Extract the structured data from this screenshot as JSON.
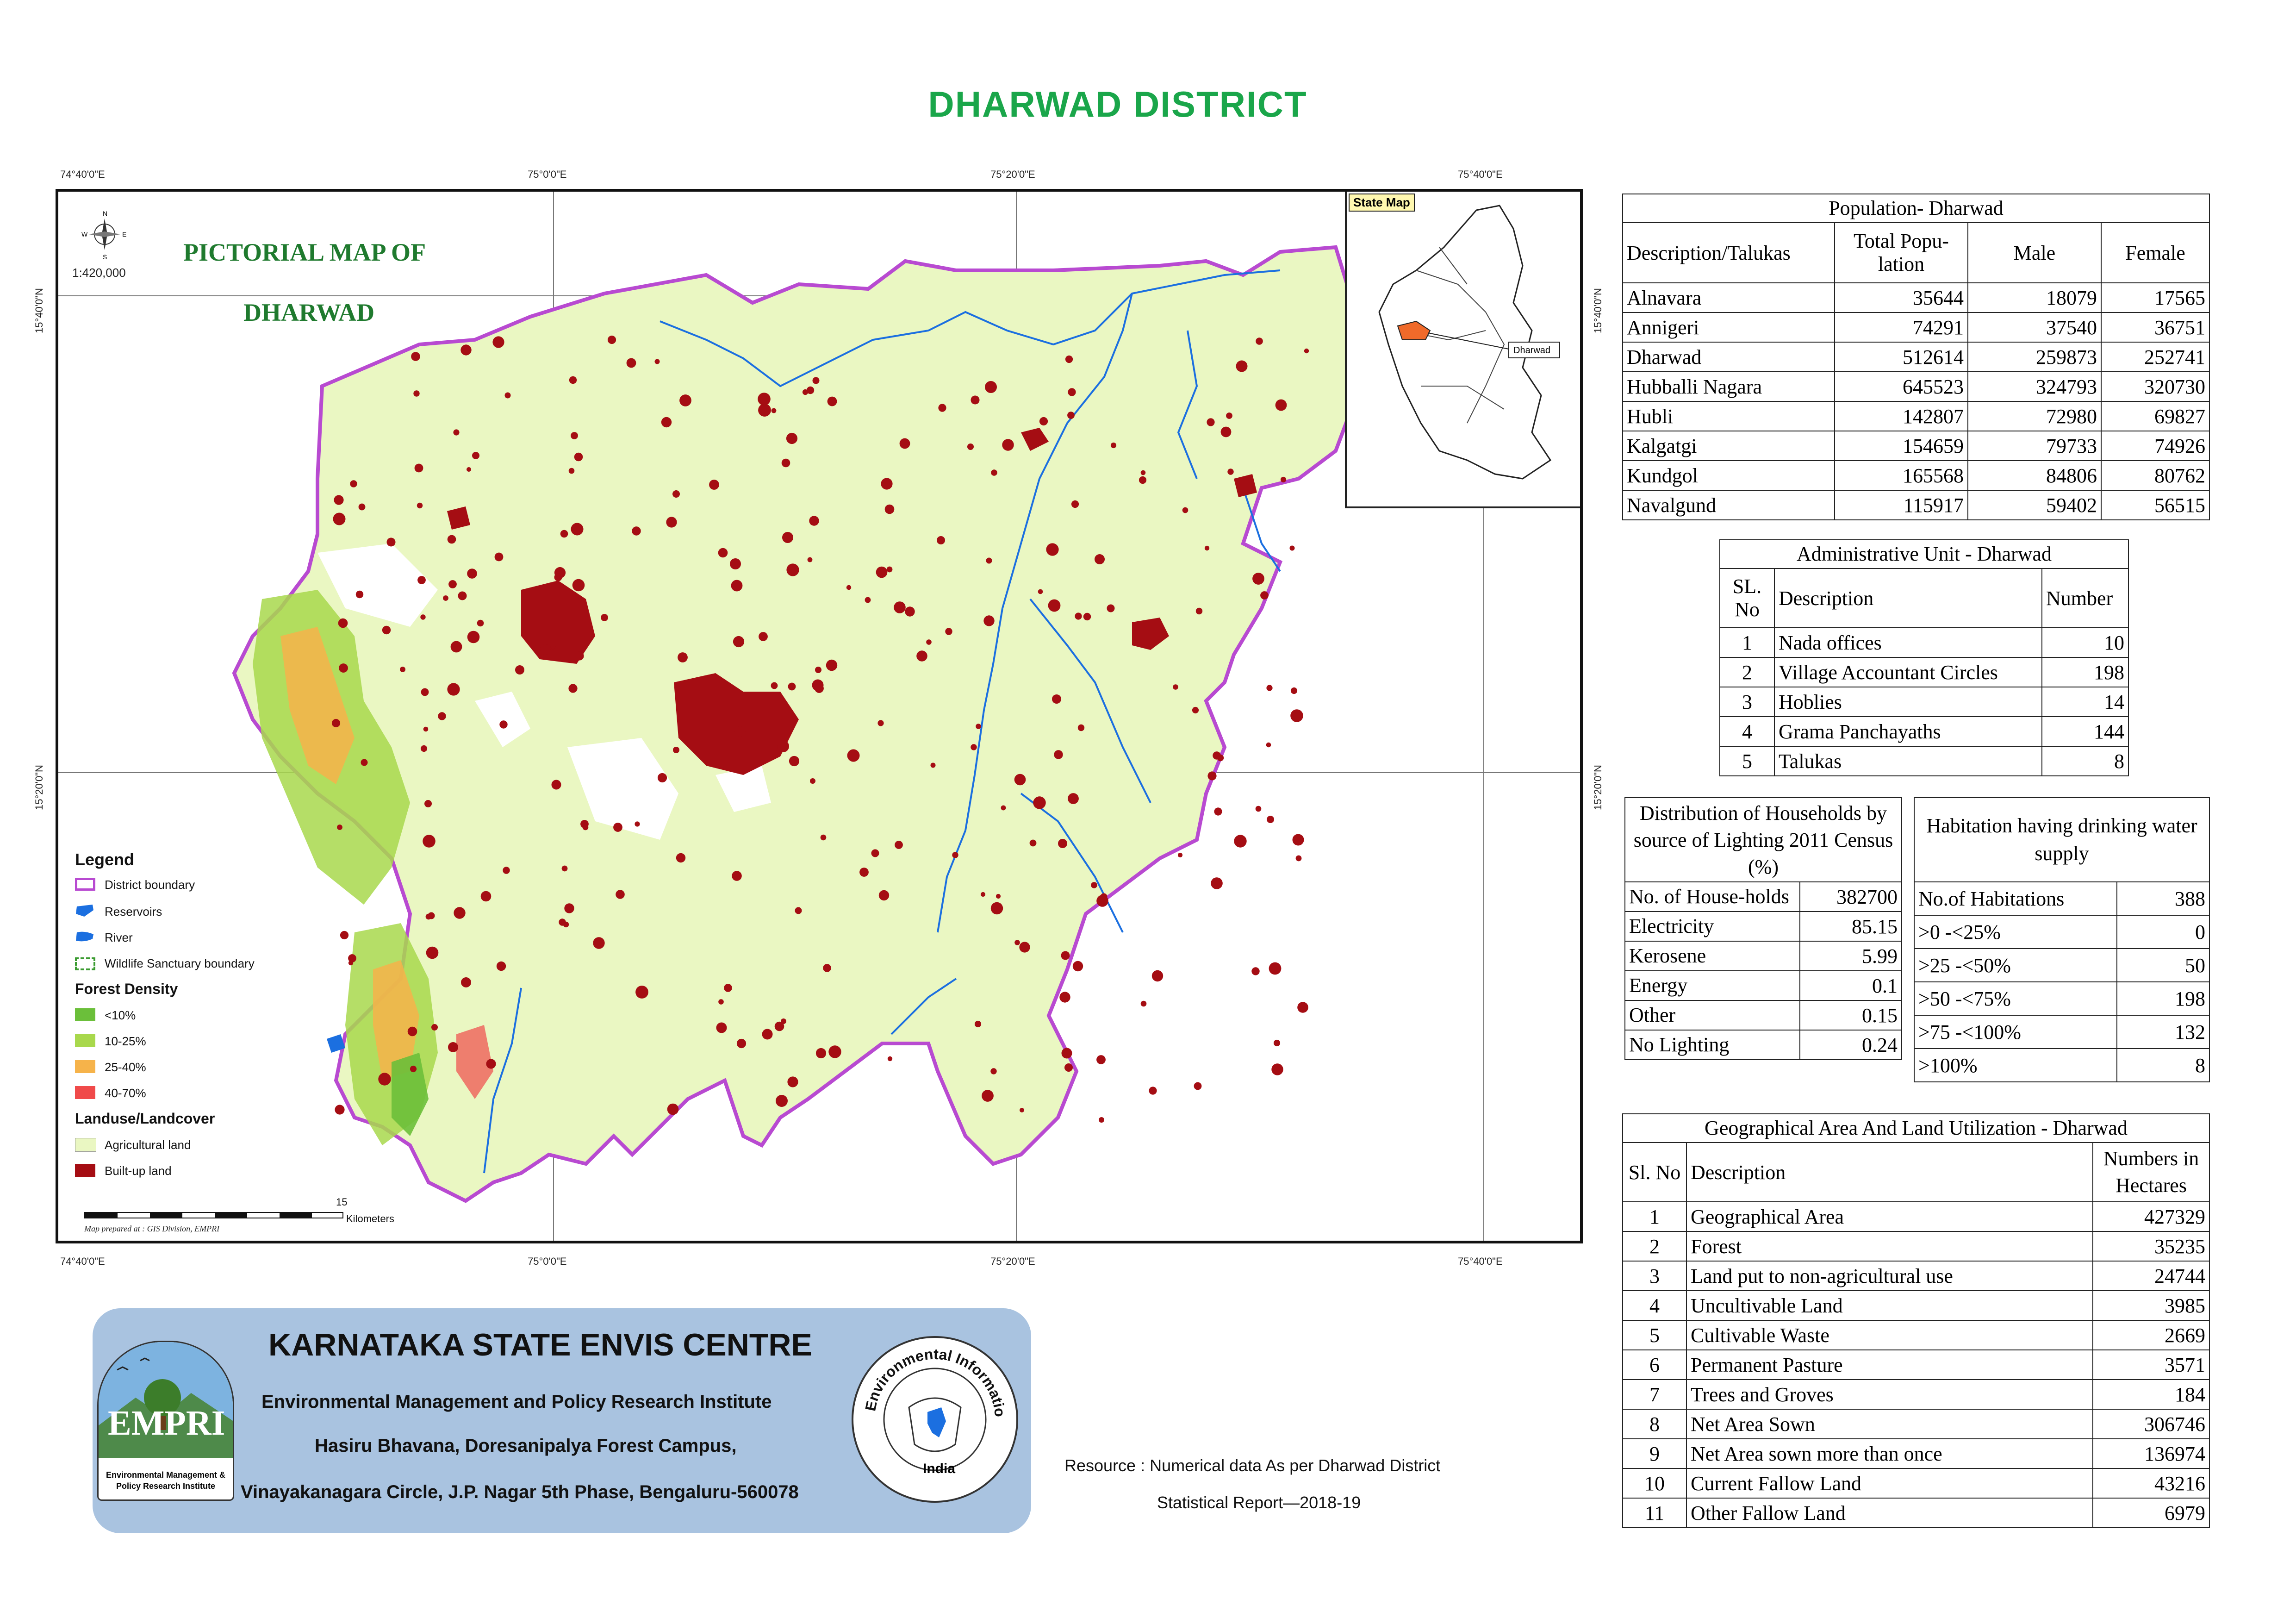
{
  "title": "DHARWAD DISTRICT",
  "map": {
    "heading_line1": "PICTORIAL MAP OF",
    "heading_line2": "DHARWAD",
    "scale_text": "1:420,000",
    "compass": {
      "n": "N",
      "s": "S",
      "e": "E",
      "w": "W"
    },
    "top_ticks": [
      "74°40'0\"E",
      "75°0'0\"E",
      "75°20'0\"E",
      "75°40'0\"E"
    ],
    "bottom_ticks": [
      "74°40'0\"E",
      "75°0'0\"E",
      "75°20'0\"E",
      "75°40'0\"E"
    ],
    "left_ticks": [
      "15°40'0\"N",
      "15°20'0\"N"
    ],
    "right_ticks": [
      "15°40'0\"N",
      "15°20'0\"N"
    ],
    "inset_label": "State Map",
    "inset_callout": "Dharwad",
    "scalebar_end": "15",
    "scalebar_unit": "Kilometers",
    "credit": "Map prepared at : GIS Division, EMPRI",
    "colors": {
      "agri": "#eaf7c2",
      "builtup": "#a50d13",
      "boundary": "#b84ad1",
      "river": "#1b6fe0",
      "open": "#ffffff",
      "forest1": "#6bbf3a",
      "forest2": "#a8d84c",
      "forest3": "#f6b34a",
      "forest4": "#f04a4a"
    }
  },
  "legend": {
    "title": "Legend",
    "items": [
      {
        "label": "District boundary",
        "icon": "boundary-swatch"
      },
      {
        "label": "Reservoirs",
        "icon": "reservoir-swatch"
      },
      {
        "label": "River",
        "icon": "river-swatch"
      },
      {
        "label": "Wildlife Sanctuary boundary",
        "icon": "sanctuary-swatch"
      }
    ],
    "forest_title": "Forest Density",
    "forest_items": [
      {
        "label": "<10%",
        "color": "#6bbf3a"
      },
      {
        "label": "10-25%",
        "color": "#a8d84c"
      },
      {
        "label": "25-40%",
        "color": "#f6b34a"
      },
      {
        "label": "40-70%",
        "color": "#f04a4a"
      }
    ],
    "landuse_title": "Landuse/Landcover",
    "landuse_items": [
      {
        "label": "Agricultural land",
        "color": "#eaf7c2"
      },
      {
        "label": "Built-up land",
        "color": "#a50d13"
      }
    ]
  },
  "population": {
    "caption": "Population- Dharwad",
    "headers": [
      "Description/Talukas",
      "Total Popu-lation",
      "Male",
      "Female"
    ],
    "rows": [
      [
        "Alnavara",
        "35644",
        "18079",
        "17565"
      ],
      [
        "Annigeri",
        "74291",
        "37540",
        "36751"
      ],
      [
        "Dharwad",
        "512614",
        "259873",
        "252741"
      ],
      [
        "Hubballi Nagara",
        "645523",
        "324793",
        "320730"
      ],
      [
        "Hubli",
        "142807",
        "72980",
        "69827"
      ],
      [
        "Kalgatgi",
        "154659",
        "79733",
        "74926"
      ],
      [
        "Kundgol",
        "165568",
        "84806",
        "80762"
      ],
      [
        "Navalgund",
        "115917",
        "59402",
        "56515"
      ]
    ]
  },
  "admin": {
    "caption": "Administrative Unit - Dharwad",
    "headers": [
      "SL. No",
      "Description",
      "Number"
    ],
    "rows": [
      [
        "1",
        "Nada offices",
        "10"
      ],
      [
        "2",
        "Village Accountant Circles",
        "198"
      ],
      [
        "3",
        "Hoblies",
        "14"
      ],
      [
        "4",
        "Grama Panchayaths",
        "144"
      ],
      [
        "5",
        "Talukas",
        "8"
      ]
    ]
  },
  "households": {
    "caption": "Distribution of Households by source of Lighting 2011 Census (%)",
    "rows": [
      [
        "No. of House-holds",
        "382700"
      ],
      [
        "Electricity",
        "85.15"
      ],
      [
        "Kerosene",
        "5.99"
      ],
      [
        "Energy",
        "0.1"
      ],
      [
        "Other",
        "0.15"
      ],
      [
        "No Lighting",
        "0.24"
      ]
    ]
  },
  "habitation": {
    "caption": "Habitation having drinking water supply",
    "rows": [
      [
        "No.of Habitations",
        "388"
      ],
      [
        ">0 -<25%",
        "0"
      ],
      [
        ">25 -<50%",
        "50"
      ],
      [
        ">50 -<75%",
        "198"
      ],
      [
        ">75 -<100%",
        "132"
      ],
      [
        ">100%",
        "8"
      ]
    ]
  },
  "geo": {
    "caption": "Geographical Area  And Land Utilization - Dharwad",
    "headers": [
      "Sl. No",
      "Description",
      "Numbers in Hectares"
    ],
    "rows": [
      [
        "1",
        "Geographical Area",
        "427329"
      ],
      [
        "2",
        "Forest",
        "35235"
      ],
      [
        "3",
        "Land put to non-agricultural use",
        "24744"
      ],
      [
        "4",
        "Uncultivable Land",
        "3985"
      ],
      [
        "5",
        "Cultivable Waste",
        "2669"
      ],
      [
        "6",
        "Permanent Pasture",
        "3571"
      ],
      [
        "7",
        "Trees and Groves",
        "184"
      ],
      [
        "8",
        "Net Area Sown",
        "306746"
      ],
      [
        "9",
        "Net Area sown more than once",
        "136974"
      ],
      [
        "10",
        "Current Fallow Land",
        "43216"
      ],
      [
        "11",
        "Other Fallow Land",
        "6979"
      ]
    ]
  },
  "footer": {
    "org": "KARNATAKA STATE ENVIS CENTRE",
    "line1": "Environmental Management and Policy Research Institute",
    "line2": "Hasiru Bhavana, Doresanipalya Forest Campus,",
    "line3": "Vinayakanagara Circle, J.P. Nagar 5th Phase, Bengaluru-560078",
    "logo_text": "EMPRI",
    "logo_caption1": "Environmental Management &",
    "logo_caption2": "Policy Research Institute",
    "envis_ring": "Environmental Information System",
    "envis_country": "India",
    "resource_line1": "Resource : Numerical data As per Dharwad District",
    "resource_line2": "Statistical Report—2018-19"
  }
}
